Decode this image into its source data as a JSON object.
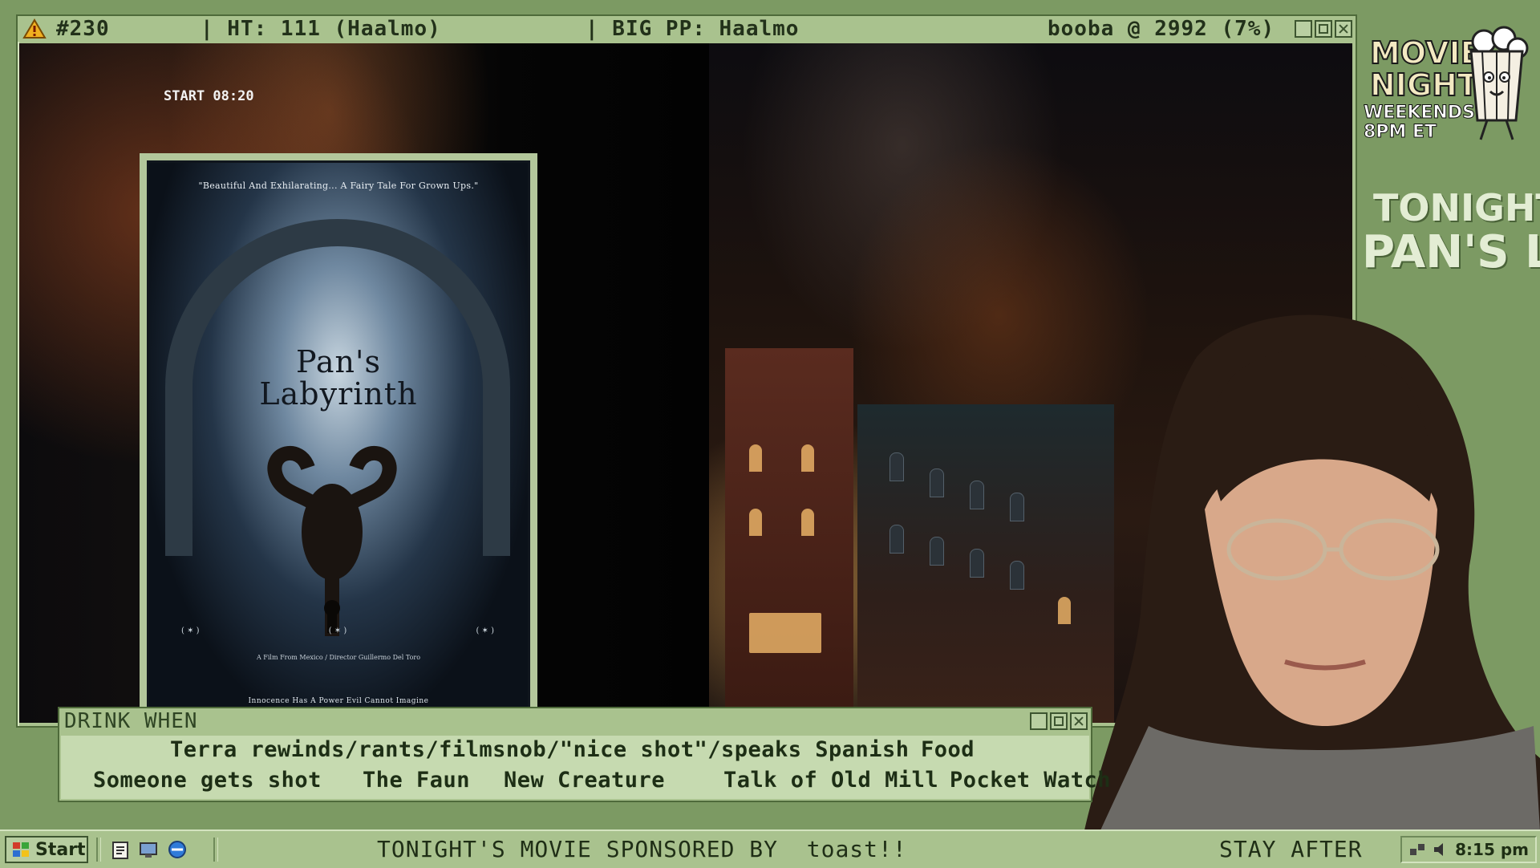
{
  "video_window": {
    "episode": "#230",
    "ht": "| HT: 111 (Haalmo)",
    "big_pp": "| BIG PP: Haalmo",
    "booba": "booba @ 2992 (7%)",
    "start_timer": "START 08:20"
  },
  "poster": {
    "quote": "\"Beautiful And Exhilarating... A Fairy Tale For Grown Ups.\"",
    "title_line1": "Pan's",
    "title_line2": "Labyrinth",
    "credit": "A Film From Mexico / Director Guillermo Del Toro",
    "tagline": "Innocence Has A Power Evil Cannot Imagine"
  },
  "drink_window": {
    "title": "DRINK WHEN",
    "row1": [
      "Terra rewinds/rants/filmsnob/\"nice shot\"/speaks Spanish",
      "Food"
    ],
    "row2": [
      "Someone gets shot",
      "The Faun",
      "New Creature",
      "Talk of Old Mill",
      "Pocket Watch"
    ]
  },
  "side_panel": {
    "logo_line1": "MOVIE",
    "logo_line2": "NIGHT",
    "logo_line3": "WEEKENDS",
    "logo_line4": "8PM ET",
    "tonight_label": "TONIGHT:",
    "tonight_movie": "PAN'S LA"
  },
  "taskbar": {
    "start_label": "Start",
    "ticker": "TONIGHT'S MOVIE SPONSORED BY  toast!!",
    "stay_after": "STAY AFTER",
    "clock": "8:15 pm"
  },
  "colors": {
    "window_chrome": "#a9c28e",
    "background": "#7c9a63",
    "drink_body": "#c6dab0",
    "text_dark": "#1f2e16"
  }
}
